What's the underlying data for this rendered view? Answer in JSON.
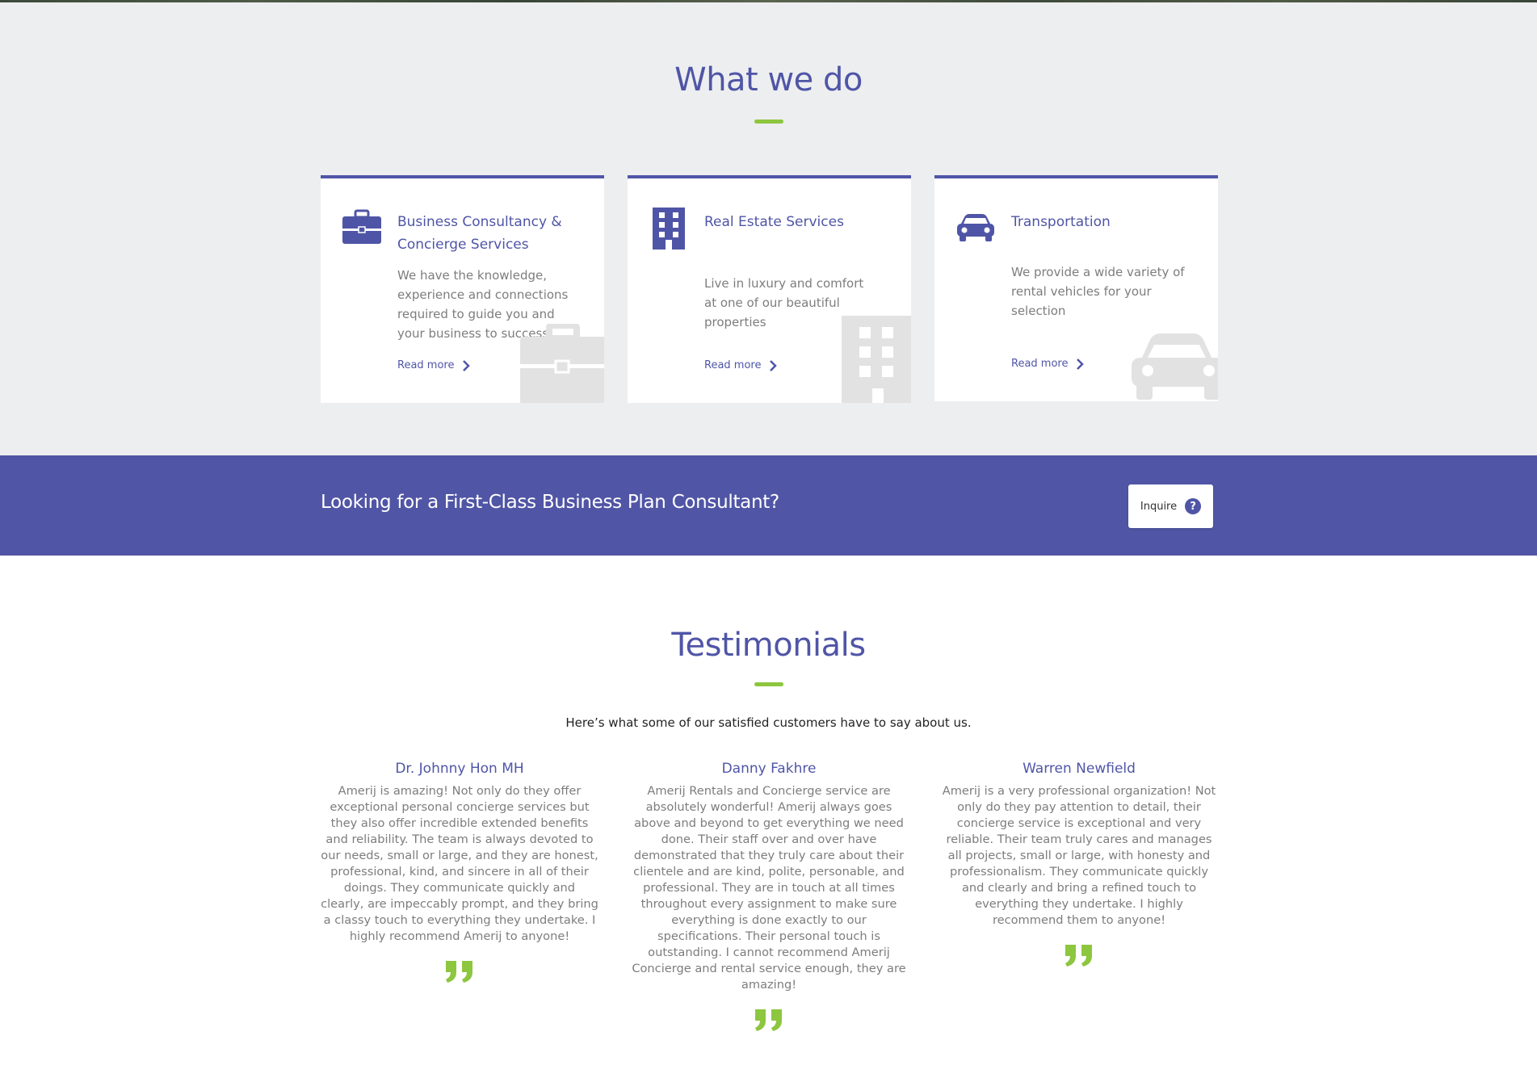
{
  "services": {
    "title": "What we do",
    "cards": [
      {
        "icon": "briefcase-icon",
        "title": "Business Consultancy & Concierge Services",
        "text": "We have the knowledge, experience and connections required to guide you and your business to success",
        "link": "Read more"
      },
      {
        "icon": "building-icon",
        "title": "Real Estate Services",
        "text": "Live in luxury and comfort at one of our beautiful properties",
        "link": "Read more"
      },
      {
        "icon": "car-icon",
        "title": "Transportation",
        "text": "We provide a wide variety of rental vehicles for your selection",
        "link": "Read more"
      }
    ]
  },
  "cta": {
    "text": "Looking for a First-Class Business Plan Consultant?",
    "button": "Inquire"
  },
  "testimonials": {
    "title": "Testimonials",
    "intro": "Here’s what some of our satisfied customers have to say about us.",
    "items": [
      {
        "name": "Dr. Johnny Hon MH",
        "text": "Amerij is amazing! Not only do they offer exceptional personal concierge services but they also offer incredible extended benefits and reliability. The team is always devoted to our needs, small or large, and they are honest, professional, kind, and sincere in all of their doings. They communicate quickly and clearly, are impeccably prompt, and they bring a classy touch to everything they undertake. I highly recommend Amerij to anyone!"
      },
      {
        "name": "Danny Fakhre",
        "text": "Amerij Rentals and Concierge service are absolutely wonderful! Amerij always goes above and beyond to get everything we need done. Their staff over and over have demonstrated that they truly care about their clientele and are kind, polite, personable, and professional. They are in touch at all times throughout every assignment to make sure everything is done exactly to our specifications. Their personal touch is outstanding. I cannot recommend Amerij Concierge and rental service enough, they are amazing!"
      },
      {
        "name": "Warren Newfield",
        "text": "Amerij is a very professional organization! Not only do they pay attention to detail, their concierge service is exceptional and very reliable. Their team truly cares and manages all projects, small or large, with honesty and professionalism. They communicate quickly and clearly and bring a refined touch to everything they undertake. I highly recommend them to anyone!"
      }
    ]
  },
  "colors": {
    "primary": "#4f55a6",
    "accent": "#8dc63f",
    "section_bg": "#edeef0",
    "cta_bg": "#5055a5"
  }
}
